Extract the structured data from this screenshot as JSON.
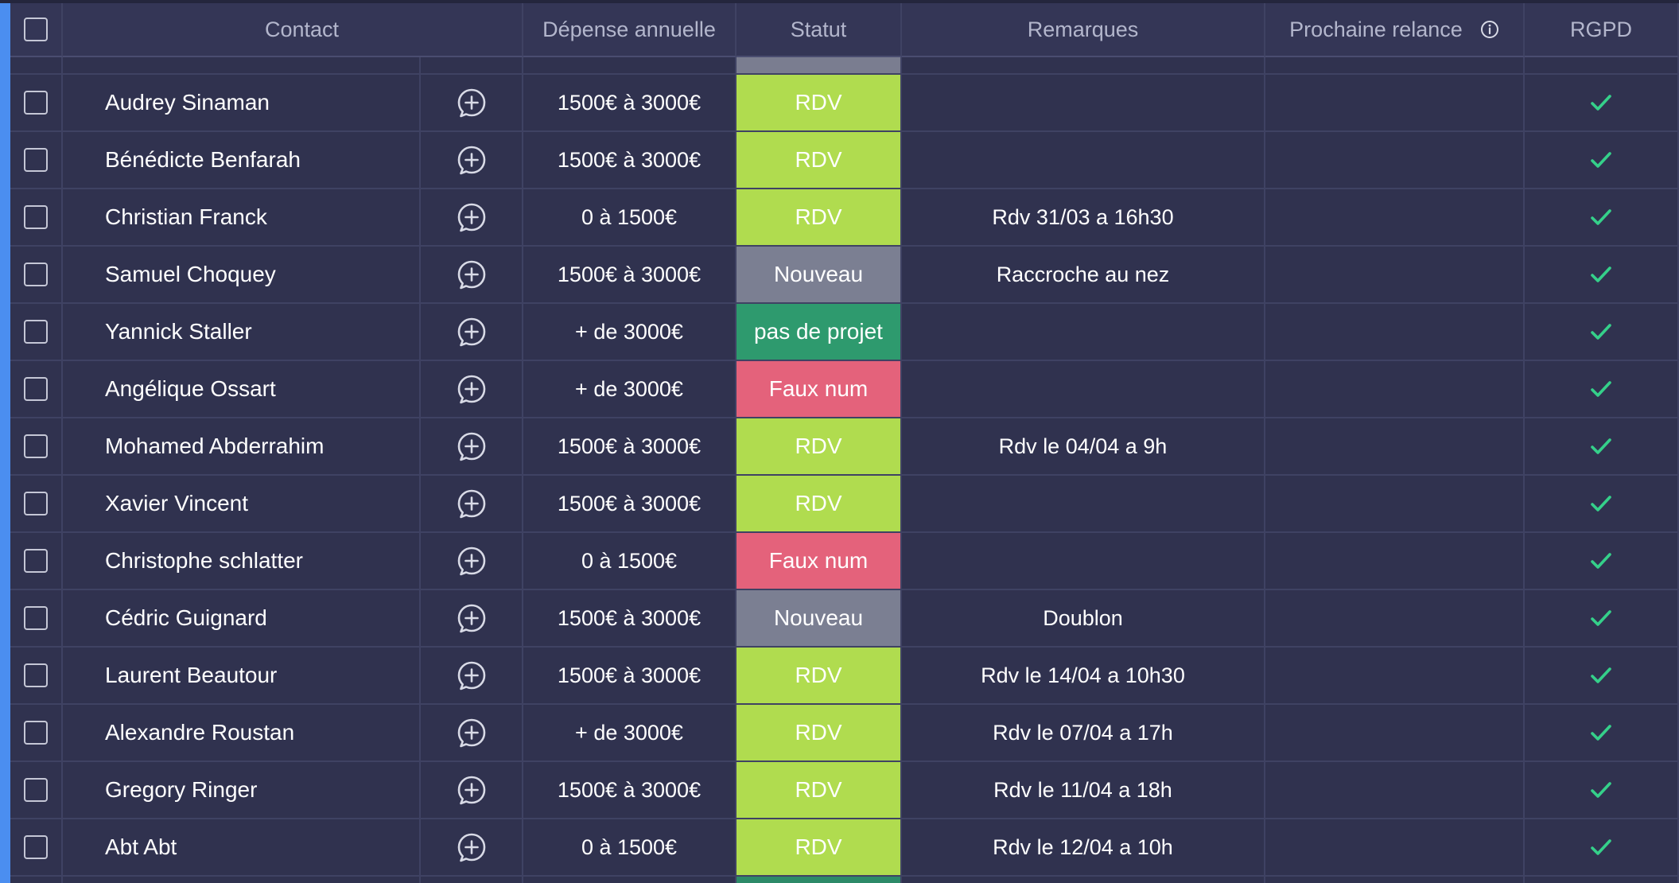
{
  "header": {
    "contact": "Contact",
    "depense": "Dépense annuelle",
    "statut": "Statut",
    "remarques": "Remarques",
    "prochaine_relance": "Prochaine relance",
    "rgpd": "RGPD"
  },
  "status_colors": {
    "RDV": "#b0dc4f",
    "Nouveau": "#7b7f92",
    "pas de projet": "#2e9a6e",
    "Faux num": "#e4627b"
  },
  "check_color": "#35d08a",
  "rows": [
    {
      "name": "Audrey Sinaman",
      "depense": "1500€ à 3000€",
      "status": "RDV",
      "remarque": "",
      "relance": "",
      "rgpd": true
    },
    {
      "name": "Bénédicte Benfarah",
      "depense": "1500€ à 3000€",
      "status": "RDV",
      "remarque": "",
      "relance": "",
      "rgpd": true
    },
    {
      "name": "Christian Franck",
      "depense": "0 à 1500€",
      "status": "RDV",
      "remarque": "Rdv 31/03 a 16h30",
      "relance": "",
      "rgpd": true
    },
    {
      "name": "Samuel Choquey",
      "depense": "1500€ à 3000€",
      "status": "Nouveau",
      "remarque": "Raccroche au nez",
      "relance": "",
      "rgpd": true
    },
    {
      "name": "Yannick Staller",
      "depense": "+ de 3000€",
      "status": "pas de projet",
      "remarque": "",
      "relance": "",
      "rgpd": true
    },
    {
      "name": "Angélique Ossart",
      "depense": "+ de 3000€",
      "status": "Faux num",
      "remarque": "",
      "relance": "",
      "rgpd": true
    },
    {
      "name": "Mohamed Abderrahim",
      "depense": "1500€ à 3000€",
      "status": "RDV",
      "remarque": "Rdv le 04/04 a 9h",
      "relance": "",
      "rgpd": true
    },
    {
      "name": "Xavier Vincent",
      "depense": "1500€ à 3000€",
      "status": "RDV",
      "remarque": "",
      "relance": "",
      "rgpd": true
    },
    {
      "name": "Christophe schlatter",
      "depense": "0 à 1500€",
      "status": "Faux num",
      "remarque": "",
      "relance": "",
      "rgpd": true
    },
    {
      "name": "Cédric Guignard",
      "depense": "1500€ à 3000€",
      "status": "Nouveau",
      "remarque": "Doublon",
      "relance": "",
      "rgpd": true
    },
    {
      "name": "Laurent Beautour",
      "depense": "1500€ à 3000€",
      "status": "RDV",
      "remarque": "Rdv le 14/04 a 10h30",
      "relance": "",
      "rgpd": true
    },
    {
      "name": "Alexandre Roustan",
      "depense": "+ de 3000€",
      "status": "RDV",
      "remarque": "Rdv le 07/04 a 17h",
      "relance": "",
      "rgpd": true
    },
    {
      "name": "Gregory Ringer",
      "depense": "1500€ à 3000€",
      "status": "RDV",
      "remarque": "Rdv le 11/04 a 18h",
      "relance": "",
      "rgpd": true
    },
    {
      "name": "Abt Abt",
      "depense": "0 à 1500€",
      "status": "RDV",
      "remarque": "Rdv le 12/04 a 10h",
      "relance": "",
      "rgpd": true
    }
  ]
}
